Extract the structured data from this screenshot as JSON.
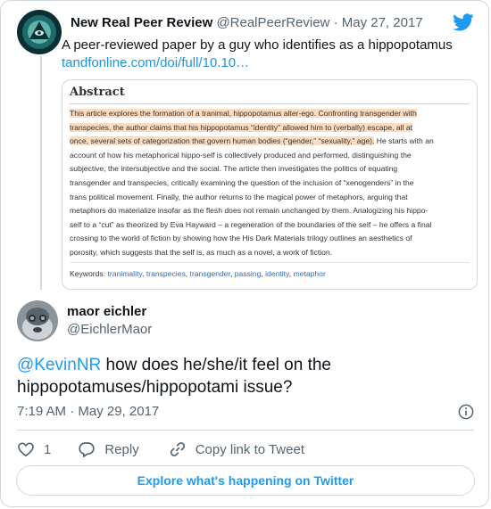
{
  "quoted_tweet": {
    "display_name": "New Real Peer Review",
    "handle": "@RealPeerReview",
    "separator": "·",
    "date": "May 27, 2017",
    "text": "A peer-reviewed paper by a guy who identifies as a hippopotamus",
    "link": "tandfonline.com/doi/full/10.10…",
    "abstract_image": {
      "title": "Abstract",
      "highlight_color": "#fbdcc1",
      "lines": [
        {
          "hl": "This article explores the formation of a tranimal, hippopotamus alter-ego. Confronting transgender with",
          "rest": ""
        },
        {
          "hl": "transpecies, the author claims that his hippopotamus “identity” allowed him to (verbally) escape, all at",
          "rest": ""
        },
        {
          "hl": "once, several sets of categorization that govern human bodies (“gender,” “sexuality,” age).",
          "rest": " He starts with an"
        },
        {
          "hl": "",
          "rest": "account of how his metaphorical hippo-self is collectively produced and performed, distinguishing the"
        },
        {
          "hl": "",
          "rest": "subjective, the intersubjective and the social. The article then investigates the politics of equating"
        },
        {
          "hl": "",
          "rest": "transgender and transpecies, critically examining the question of the inclusion of “xenogenders” in the"
        },
        {
          "hl": "",
          "rest": "trans political movement. Finally, the author returns to the magical power of metaphors, arguing that"
        },
        {
          "hl": "",
          "rest": "metaphors do materialize insofar as the flesh does not remain unchanged by them. Analogizing his hippo-"
        },
        {
          "hl": "",
          "rest": "self to a “cut” as theorized by Eva Hayward – a regeneration of the boundaries of the self – he offers a final"
        },
        {
          "hl": "",
          "rest": "crossing to the world of fiction by showing how the His Dark Materials trilogy outlines an aesthetics of"
        },
        {
          "hl": "",
          "rest": "porosity, which suggests that the self is, as much as a novel, a work of fiction."
        }
      ],
      "keywords_label": "Keywords:",
      "keywords": [
        "tranimality",
        "transpecies",
        "transgender",
        "passing",
        "identity",
        "metaphor"
      ]
    }
  },
  "reply": {
    "display_name": "maor eichler",
    "handle": "@EichlerMaor",
    "mention": "@KevinNR",
    "text": " how does he/she/it feel on the hippopotamuses/hippopotami issue?",
    "time": "7:19 AM · May 29, 2017"
  },
  "actions": {
    "like_count": "1",
    "reply_label": "Reply",
    "copy_label": "Copy link to Tweet"
  },
  "explore_label": "Explore what's happening on Twitter",
  "colors": {
    "twitter_blue": "#1d9bf0",
    "link_blue": "#1b95e0",
    "secondary_text": "#536471",
    "border": "#cfd9de"
  },
  "icons": [
    "twitter-bird-icon",
    "info-icon",
    "heart-icon",
    "reply-bubble-icon",
    "link-icon"
  ]
}
